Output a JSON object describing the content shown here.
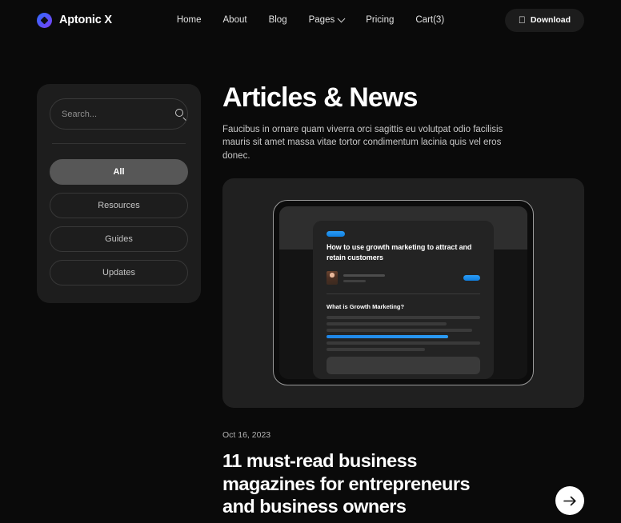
{
  "brand": {
    "name": "Aptonic X",
    "logo_icon": "diamond-logo-icon"
  },
  "nav": {
    "items": [
      {
        "label": "Home"
      },
      {
        "label": "About"
      },
      {
        "label": "Blog"
      },
      {
        "label": "Pages",
        "has_dropdown": true
      },
      {
        "label": "Pricing"
      },
      {
        "label": "Cart(3)"
      }
    ]
  },
  "download": {
    "label": "Download",
    "icon": "apple-icon",
    "glyph": ""
  },
  "sidebar": {
    "search": {
      "placeholder": "Search...",
      "value": "",
      "icon": "search-icon"
    },
    "filters": [
      {
        "label": "All",
        "active": true
      },
      {
        "label": "Resources",
        "active": false
      },
      {
        "label": "Guides",
        "active": false
      },
      {
        "label": "Updates",
        "active": false
      }
    ]
  },
  "main": {
    "title": "Articles & News",
    "description": "Faucibus in ornare quam viverra orci sagittis eu volutpat odio facilisis mauris sit amet massa vitae tortor condimentum lacinia quis vel eros donec.",
    "featured": {
      "mockup": {
        "article_title": "How to use growth marketing to attract and retain customers",
        "section_heading": "What is Growth Marketing?",
        "accent_color": "#1e86e8"
      }
    },
    "post": {
      "date": "Oct 16, 2023",
      "title": "11 must-read business magazines for entrepreneurs and business owners",
      "read_more_icon": "arrow-right-icon"
    }
  },
  "colors": {
    "background": "#0a0a0a",
    "panel": "#1d1d1d",
    "card": "#202020",
    "accent_blue": "#1e86e8",
    "active_filter": "#575757"
  }
}
